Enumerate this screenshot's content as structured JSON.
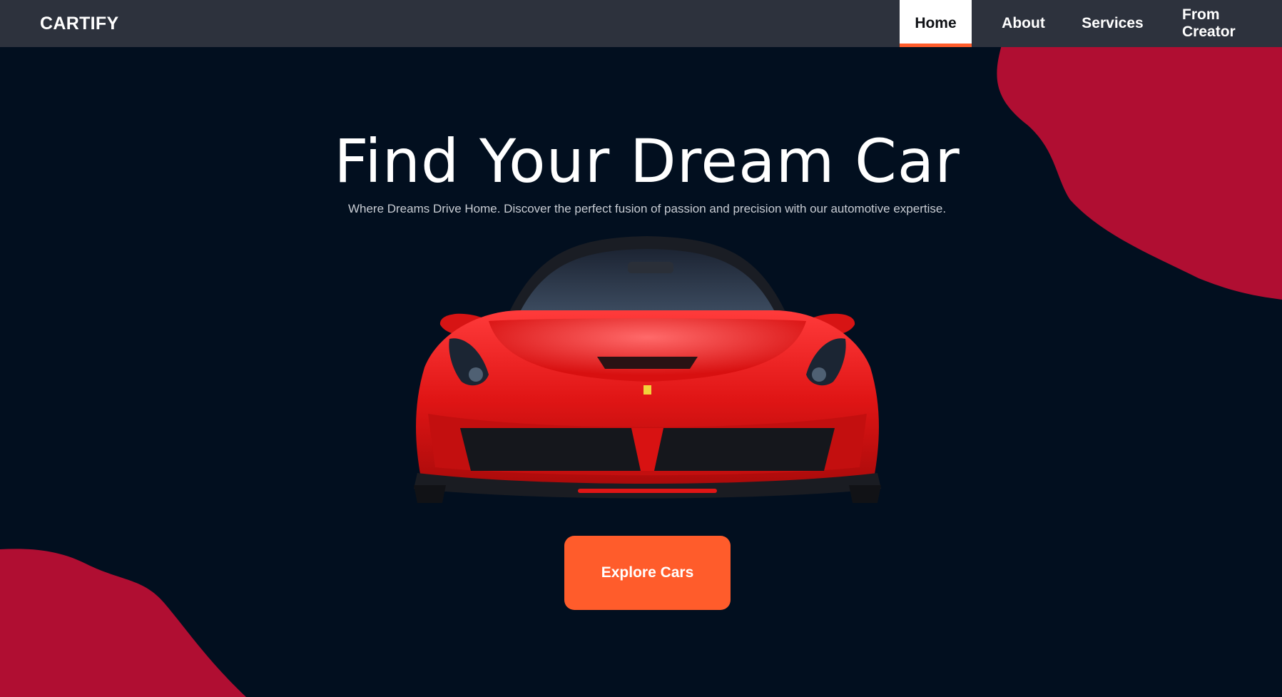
{
  "brand": {
    "name": "CARTIFY"
  },
  "nav": {
    "items": [
      {
        "label": "Home",
        "active": true
      },
      {
        "label": "About",
        "active": false
      },
      {
        "label": "Services",
        "active": false
      },
      {
        "label": "From Creator",
        "active": false
      }
    ]
  },
  "hero": {
    "title": "Find Your Dream Car",
    "subtitle": "Where Dreams Drive Home. Discover the perfect fusion of passion and precision with our automotive expertise.",
    "cta_label": "Explore Cars",
    "image": "red-sports-car"
  },
  "colors": {
    "background": "#020f1f",
    "navbar": "#2d323d",
    "accent": "#ff5c2b",
    "blob": "#b00e32"
  }
}
